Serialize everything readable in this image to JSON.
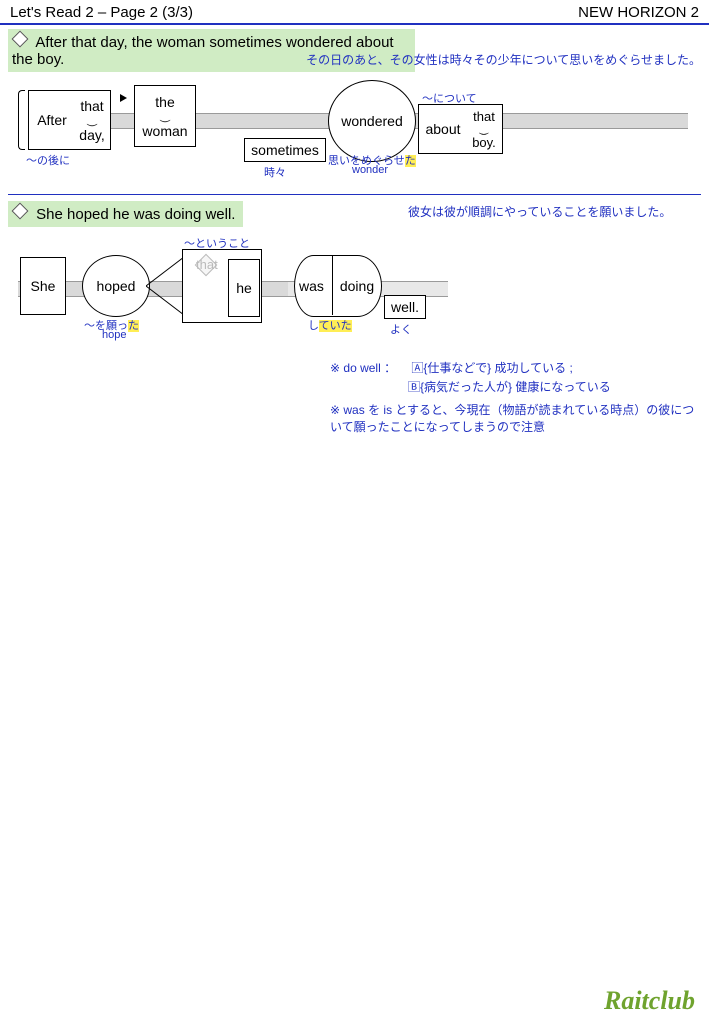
{
  "header": {
    "left": "Let's Read 2 – Page 2 (3/3)",
    "right": "NEW HORIZON 2"
  },
  "s1": {
    "en": "After that day, the woman sometimes wondered about the boy.",
    "jp": "その日のあと、その女性は時々その少年について思いをめぐらせました。",
    "words": {
      "after": "After",
      "that": "that",
      "day": "day,",
      "the1": "the",
      "woman": "woman",
      "sometimes": "sometimes",
      "wondered": "wondered",
      "about": "about",
      "that2": "that",
      "boy": "boy."
    },
    "notes": {
      "after": "〜の後に",
      "sometimes": "時々",
      "wondered_jp": "思いをめぐらせ",
      "wondered_hl": "た",
      "wonder_en": "wonder",
      "about": "〜について"
    }
  },
  "s2": {
    "en": "She hoped he was doing well.",
    "jp": "彼女は彼が順調にやっていることを願いました。",
    "words": {
      "she": "She",
      "hoped": "hoped",
      "that": "that",
      "he": "he",
      "was": "was",
      "doing": "doing",
      "well": "well."
    },
    "notes": {
      "that": "〜ということ",
      "hoped_jp": "〜を願っ",
      "hoped_hl": "た",
      "hope_en": "hope",
      "was_jp": "し",
      "was_hl": "ていた",
      "well": "よく"
    }
  },
  "footnotes": {
    "n1": "※ do well ： 　🄰{仕事などで}  成功している  ;",
    "n1b": "🄱{病気だった人が}  健康になっている",
    "n2": "※ was を is とすると、今現在（物語が読まれている時点）の彼について願ったことになってしまうので注意"
  },
  "footer": "Raitclub"
}
